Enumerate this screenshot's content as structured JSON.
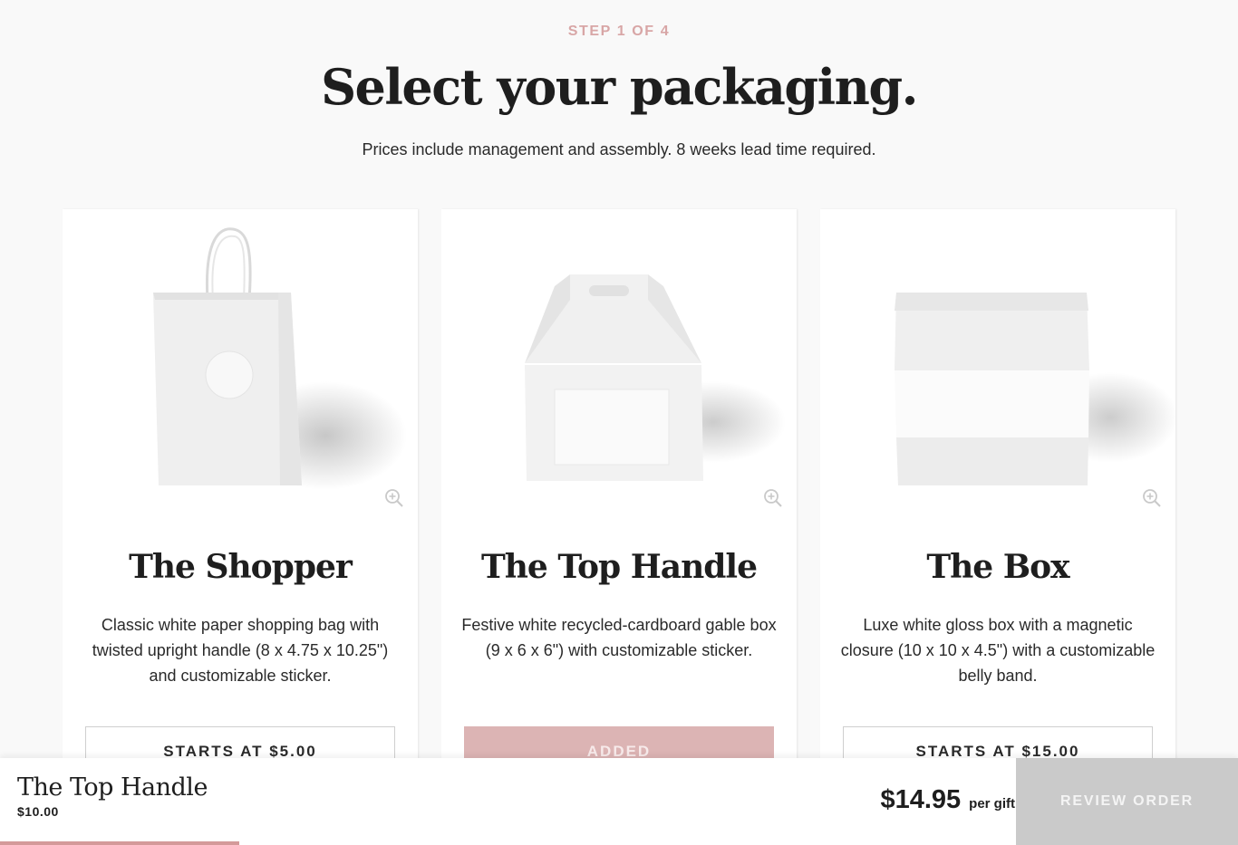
{
  "header": {
    "step": "STEP 1 OF 4",
    "title": "Select your packaging.",
    "subtitle": "Prices include management and assembly. 8 weeks lead time required."
  },
  "cards": [
    {
      "name": "The Shopper",
      "description": "Classic white paper shopping bag with twisted upright handle (8 x 4.75 x 10.25\") and customizable sticker.",
      "button_label": "STARTS AT $5.00",
      "state": "available",
      "image_icon": "shopping-bag-image",
      "zoom_icon": "zoom-in-icon"
    },
    {
      "name": "The Top Handle",
      "description": "Festive white recycled-cardboard gable box (9 x 6 x 6\") with customizable sticker.",
      "button_label": "ADDED",
      "state": "added",
      "image_icon": "gable-box-image",
      "zoom_icon": "zoom-in-icon"
    },
    {
      "name": "The Box",
      "description": "Luxe white gloss box with a magnetic closure (10 x 10 x 4.5\") with a customizable belly band.",
      "button_label": "STARTS AT $15.00",
      "state": "available",
      "image_icon": "gift-box-image",
      "zoom_icon": "zoom-in-icon"
    }
  ],
  "summary": {
    "selected_name": "The Top Handle",
    "selected_price": "$10.00",
    "total_amount": "$14.95",
    "total_unit": "per gift",
    "review_label": "REVIEW ORDER",
    "progress_percent": 19.3
  },
  "colors": {
    "accent": "#d49a9a",
    "added_button": "#dcb4b4",
    "step_text": "#d8a6a6",
    "review_disabled": "#cacaca"
  }
}
